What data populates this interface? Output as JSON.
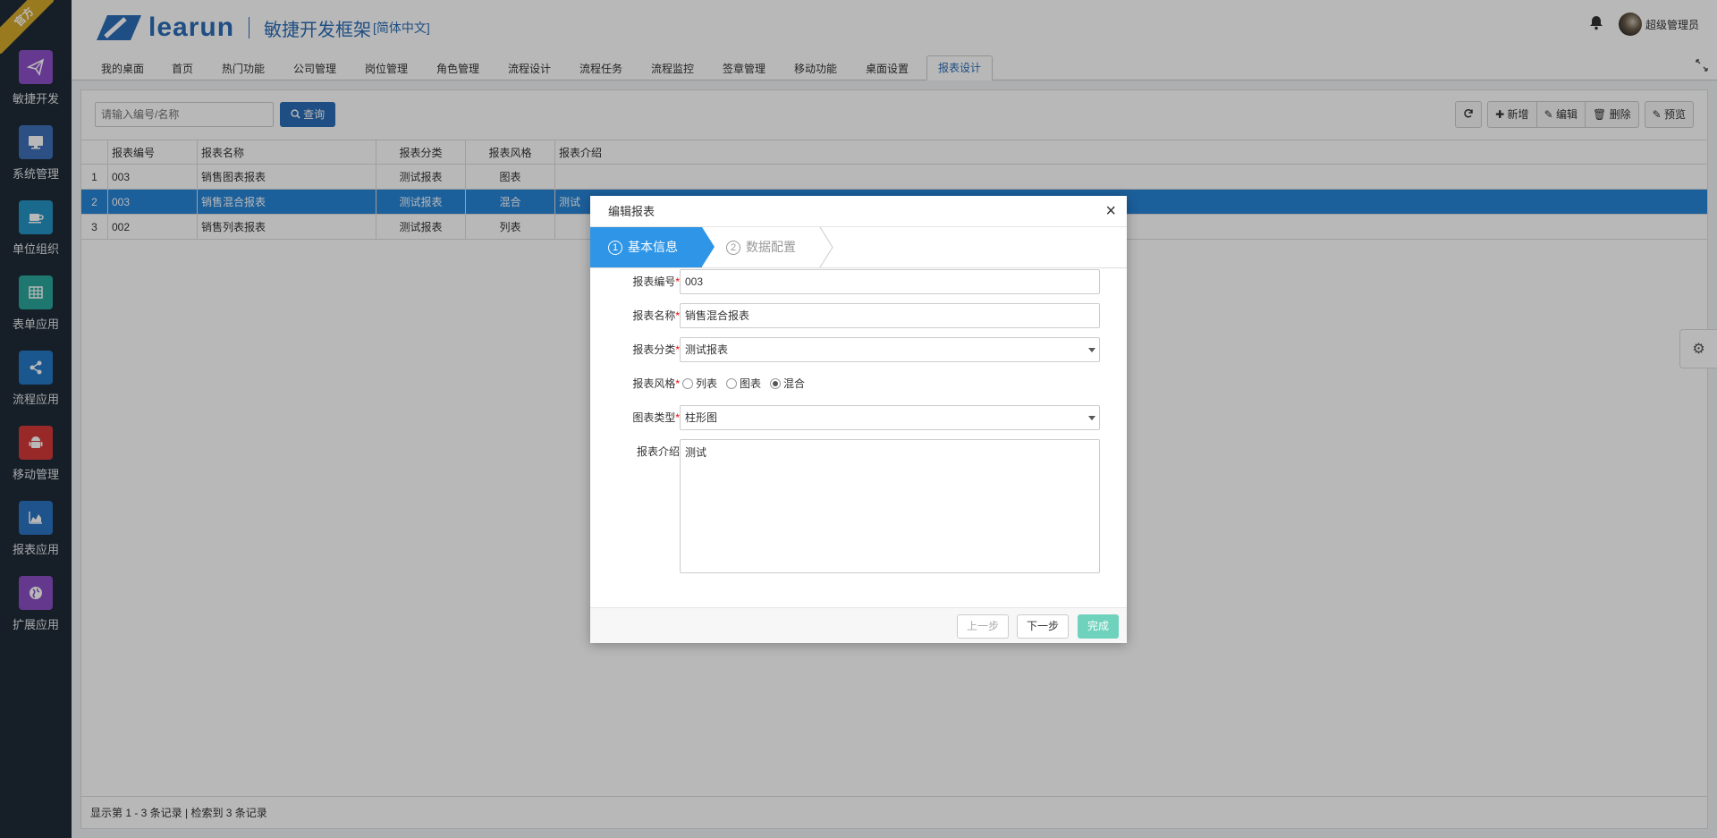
{
  "ribbon": "官方",
  "sidebar": {
    "items": [
      {
        "label": "敏捷开发",
        "color": "#8e4fc8"
      },
      {
        "label": "系统管理",
        "color": "#3e6fb8"
      },
      {
        "label": "单位组织",
        "color": "#2494c4"
      },
      {
        "label": "表单应用",
        "color": "#2aa79b"
      },
      {
        "label": "流程应用",
        "color": "#2579c7"
      },
      {
        "label": "移动管理",
        "color": "#d43a3a"
      },
      {
        "label": "报表应用",
        "color": "#2a74c2"
      },
      {
        "label": "扩展应用",
        "color": "#8a4ec4"
      }
    ]
  },
  "header": {
    "logo_text": "learun",
    "subtitle": "敏捷开发框架",
    "lang": "[简体中文]",
    "user": "超级管理员"
  },
  "tabs": [
    "我的桌面",
    "首页",
    "热门功能",
    "公司管理",
    "岗位管理",
    "角色管理",
    "流程设计",
    "流程任务",
    "流程监控",
    "签章管理",
    "移动功能",
    "桌面设置",
    "报表设计"
  ],
  "search": {
    "placeholder": "请输入编号/名称",
    "button": "查询"
  },
  "toolbar": {
    "add": "新增",
    "edit": "编辑",
    "delete": "删除",
    "preview": "预览"
  },
  "grid": {
    "headers": [
      "报表编号",
      "报表名称",
      "报表分类",
      "报表风格",
      "报表介绍"
    ],
    "rows": [
      {
        "num": "1",
        "code": "003",
        "name": "销售图表报表",
        "cat": "测试报表",
        "style": "图表",
        "desc": ""
      },
      {
        "num": "2",
        "code": "003",
        "name": "销售混合报表",
        "cat": "测试报表",
        "style": "混合",
        "desc": "测试"
      },
      {
        "num": "3",
        "code": "002",
        "name": "销售列表报表",
        "cat": "测试报表",
        "style": "列表",
        "desc": ""
      }
    ]
  },
  "footer": "显示第 1 - 3 条记录 | 检索到 3 条记录",
  "dialog": {
    "title": "编辑报表",
    "close": "×",
    "step1_num": "1",
    "step1": "基本信息",
    "step2_num": "2",
    "step2": "数据配置",
    "fields": {
      "code_label": "报表编号",
      "code_value": "003",
      "name_label": "报表名称",
      "name_value": "销售混合报表",
      "cat_label": "报表分类",
      "cat_value": "测试报表",
      "style_label": "报表风格",
      "style_opts": [
        "列表",
        "图表",
        "混合"
      ],
      "chart_label": "图表类型",
      "chart_value": "柱形图",
      "desc_label": "报表介绍",
      "desc_value": "测试",
      "req": "*"
    },
    "buttons": {
      "prev": "上一步",
      "next": "下一步",
      "done": "完成"
    }
  }
}
